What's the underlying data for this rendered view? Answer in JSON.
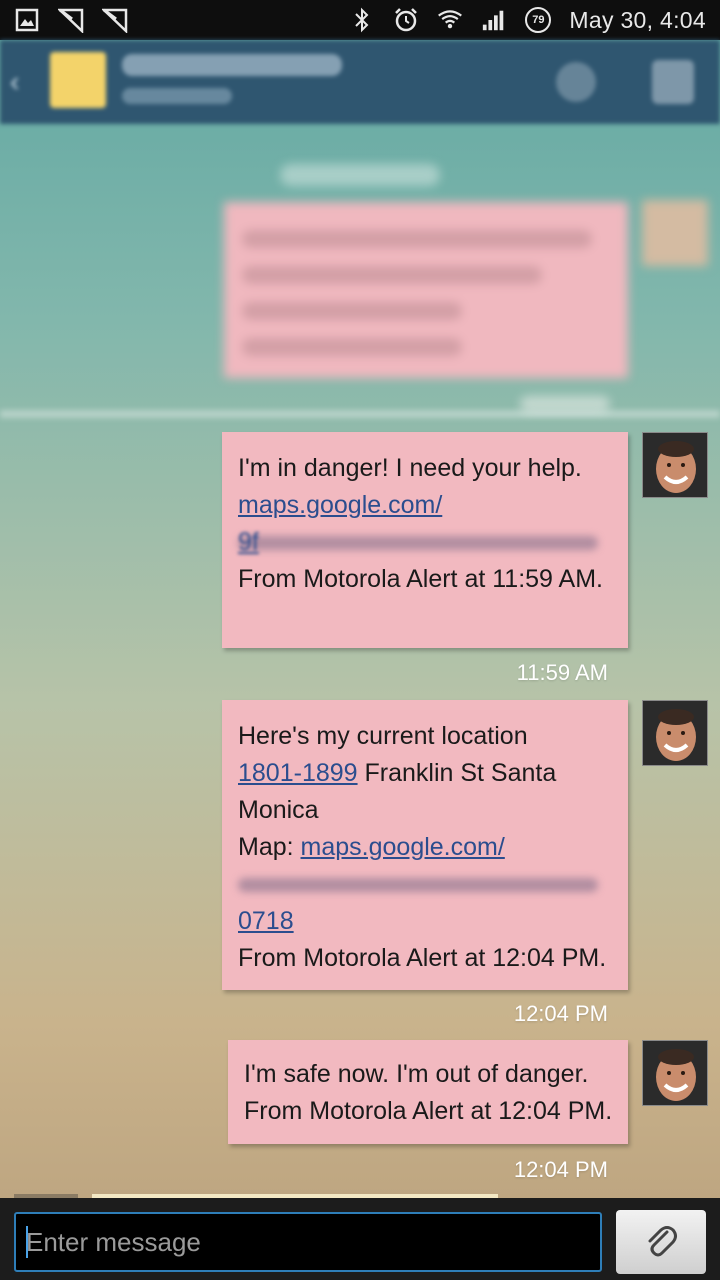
{
  "status_bar": {
    "time": "May 30, 4:04",
    "battery_level": "79",
    "icons": [
      "gallery-icon",
      "missed-call-icon",
      "missed-call-icon",
      "bluetooth-icon",
      "alarm-icon",
      "wifi-icon",
      "signal-icon"
    ]
  },
  "conversation": {
    "messages": [
      {
        "lines": [
          "I'm in danger! I need your help."
        ],
        "link_line": "maps.google.com/",
        "redacted_tail": "9f",
        "footer": "From Motorola Alert at 11:59 AM.",
        "time": "11:59 AM"
      },
      {
        "line1": "Here's my current location",
        "address_link": "1801-1899",
        "address_rest": " Franklin St Santa",
        "line3": "Monica",
        "map_label": "Map: ",
        "map_link": "maps.google.com/",
        "redacted_tail": "0718",
        "footer": "From Motorola Alert at 12:04 PM.",
        "time": "12:04 PM"
      },
      {
        "lines": [
          "I'm safe now. I'm out of danger.",
          "From Motorola Alert at 12:04 PM."
        ],
        "time": "12:04 PM"
      }
    ],
    "previous_time_partial": "11:58 AM"
  },
  "composer": {
    "placeholder": "Enter message"
  },
  "colors": {
    "bubble": "#f2b9c0",
    "link": "#2b4d8e",
    "input_border": "#2e7eb8"
  }
}
